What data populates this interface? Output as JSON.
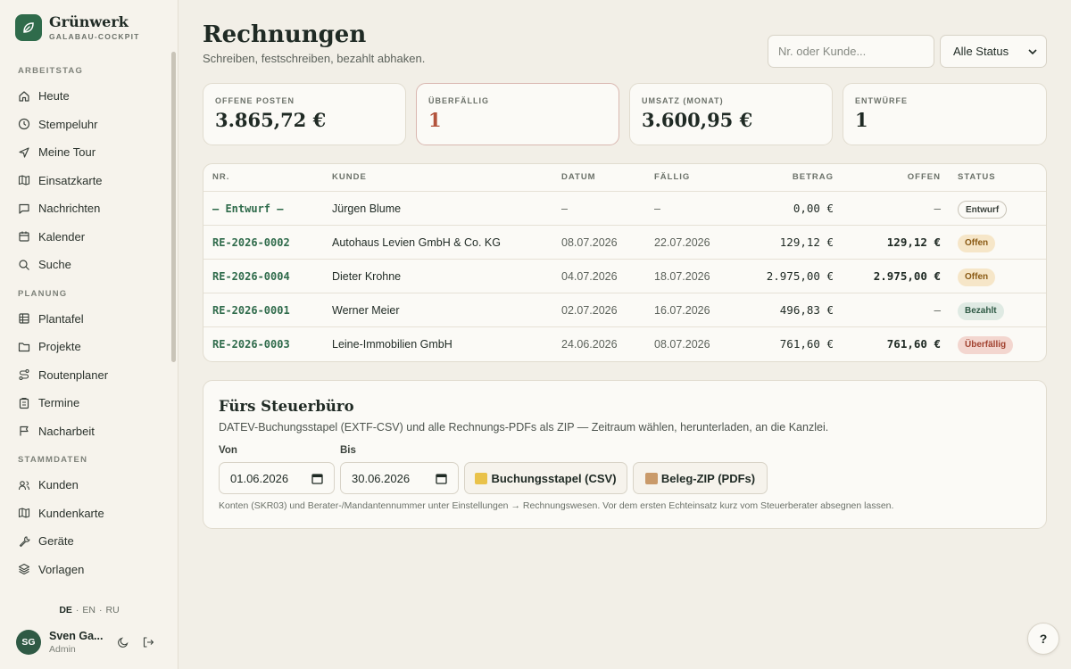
{
  "brand": {
    "name": "Grünwerk",
    "subtitle": "GALABAU-COCKPIT"
  },
  "sidebar": {
    "sections": [
      {
        "title": "ARBEITSTAG",
        "items": [
          {
            "label": "Heute",
            "icon": "home-icon"
          },
          {
            "label": "Stempeluhr",
            "icon": "clock-icon"
          },
          {
            "label": "Meine Tour",
            "icon": "navigation-icon"
          },
          {
            "label": "Einsatzkarte",
            "icon": "map-icon"
          },
          {
            "label": "Nachrichten",
            "icon": "message-icon"
          },
          {
            "label": "Kalender",
            "icon": "calendar-icon"
          },
          {
            "label": "Suche",
            "icon": "search-icon"
          }
        ]
      },
      {
        "title": "PLANUNG",
        "items": [
          {
            "label": "Plantafel",
            "icon": "grid-icon"
          },
          {
            "label": "Projekte",
            "icon": "folder-icon"
          },
          {
            "label": "Routenplaner",
            "icon": "route-icon"
          },
          {
            "label": "Termine",
            "icon": "clipboard-icon"
          },
          {
            "label": "Nacharbeit",
            "icon": "flag-icon"
          }
        ]
      },
      {
        "title": "STAMMDATEN",
        "items": [
          {
            "label": "Kunden",
            "icon": "users-icon"
          },
          {
            "label": "Kundenkarte",
            "icon": "map-icon"
          },
          {
            "label": "Geräte",
            "icon": "wrench-icon"
          },
          {
            "label": "Vorlagen",
            "icon": "layers-icon"
          }
        ]
      }
    ],
    "languages": [
      "DE",
      "EN",
      "RU"
    ],
    "active_language": "DE",
    "user": {
      "initials": "SG",
      "name": "Sven Ga...",
      "role": "Admin"
    }
  },
  "page": {
    "title": "Rechnungen",
    "subtitle": "Schreiben, festschreiben, bezahlt abhaken."
  },
  "search": {
    "placeholder": "Nr. oder Kunde..."
  },
  "status_filter": {
    "selected": "Alle Status"
  },
  "stats": [
    {
      "label": "OFFENE POSTEN",
      "value": "3.865,72 €"
    },
    {
      "label": "ÜBERFÄLLIG",
      "value": "1"
    },
    {
      "label": "UMSATZ (MONAT)",
      "value": "3.600,95 €"
    },
    {
      "label": "ENTWÜRFE",
      "value": "1"
    }
  ],
  "table": {
    "headers": {
      "nr": "NR.",
      "kunde": "KUNDE",
      "datum": "DATUM",
      "faellig": "FÄLLIG",
      "betrag": "BETRAG",
      "offen": "OFFEN",
      "status": "STATUS"
    },
    "rows": [
      {
        "nr": "— Entwurf —",
        "kunde": "Jürgen Blume",
        "datum": "–",
        "faellig": "–",
        "betrag": "0,00 €",
        "offen": "–",
        "status": "Entwurf",
        "status_type": "draft"
      },
      {
        "nr": "RE-2026-0002",
        "kunde": "Autohaus Levien GmbH & Co. KG",
        "datum": "08.07.2026",
        "faellig": "22.07.2026",
        "betrag": "129,12 €",
        "offen": "129,12 €",
        "status": "Offen",
        "status_type": "open"
      },
      {
        "nr": "RE-2026-0004",
        "kunde": "Dieter Krohne",
        "datum": "04.07.2026",
        "faellig": "18.07.2026",
        "betrag": "2.975,00 €",
        "offen": "2.975,00 €",
        "status": "Offen",
        "status_type": "open"
      },
      {
        "nr": "RE-2026-0001",
        "kunde": "Werner Meier",
        "datum": "02.07.2026",
        "faellig": "16.07.2026",
        "betrag": "496,83 €",
        "offen": "–",
        "status": "Bezahlt",
        "status_type": "paid"
      },
      {
        "nr": "RE-2026-0003",
        "kunde": "Leine-Immobilien GmbH",
        "datum": "24.06.2026",
        "faellig": "08.07.2026",
        "betrag": "761,60 €",
        "offen": "761,60 €",
        "status": "Überfällig",
        "status_type": "overdue"
      }
    ]
  },
  "tax": {
    "title": "Fürs Steuerbüro",
    "description": "DATEV-Buchungsstapel (EXTF-CSV) und alle Rechnungs-PDFs als ZIP — Zeitraum wählen, herunterladen, an die Kanzlei.",
    "from_label": "Von",
    "from_value": "01.06.2026",
    "to_label": "Bis",
    "to_value": "30.06.2026",
    "csv_button": "Buchungsstapel (CSV)",
    "zip_button": "Beleg-ZIP (PDFs)",
    "note": "Konten (SKR03) und Berater-/Mandantennummer unter Einstellungen → Rechnungswesen. Vor dem ersten Echteinsatz kurz vom Steuerberater absegnen lassen."
  },
  "help": {
    "label": "?"
  },
  "colors": {
    "accent": "#2f6b4b",
    "background": "#f2efe7",
    "overdue": "#b3533c"
  }
}
